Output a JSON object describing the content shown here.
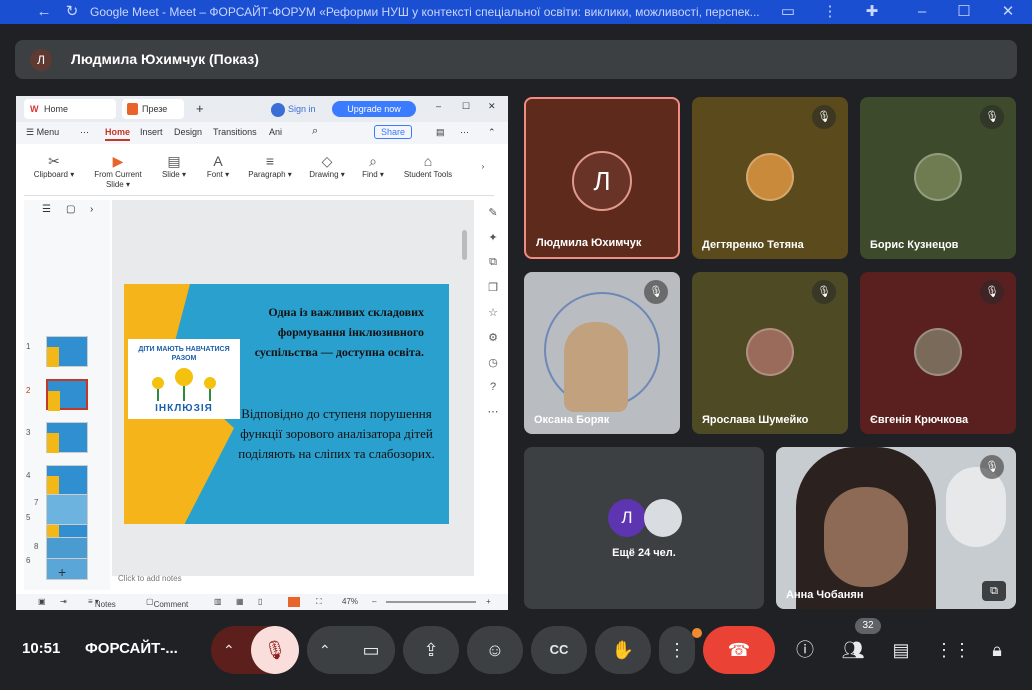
{
  "window": {
    "title": "Google Meet - Meet – ФОРСАЙТ-ФОРУМ «Реформи НУШ у контексті спеціальної освіти: виклики, можливості, перспек..."
  },
  "presenter": {
    "initial": "Л",
    "label": "Людмила Юхимчук (Показ)"
  },
  "presentation_app": {
    "tabs": [
      {
        "label": "Home"
      },
      {
        "label": "Презе"
      }
    ],
    "signin": "Sign in",
    "upgrade": "Upgrade now",
    "menu_label": "Menu",
    "ribbon_tabs": [
      "Home",
      "Insert",
      "Design",
      "Transitions",
      "Ani"
    ],
    "share_label": "Share",
    "ribbon_buttons": [
      "Clipboard",
      "From Current Slide",
      "Slide",
      "Font",
      "Paragraph",
      "Drawing",
      "Find",
      "Student Tools"
    ],
    "slide_numbers": [
      "1",
      "2",
      "3",
      "4",
      "5",
      "6",
      "7",
      "8"
    ],
    "slide": {
      "heading": "Одна із важливих складових формування інклюзивного суспільства — доступна освіта.",
      "body": "Відповідно до ступеня порушення функції зорового аналізатора дітей поділяють на сліпих та слабозорих.",
      "logo_top": "ДІТИ МАЮТЬ НАВЧАТИСЯ РАЗОМ",
      "logo_bottom": "ІНКЛЮЗІЯ"
    },
    "notes_placeholder": "Click to add notes",
    "status": {
      "notes": "Notes",
      "comment": "Comment",
      "zoom": "47%"
    }
  },
  "participants": [
    {
      "name": "Людмила Юхимчук",
      "initial": "Л",
      "muted": false
    },
    {
      "name": "Дегтяренко Тетяна",
      "muted": true
    },
    {
      "name": "Борис Кузнецов",
      "muted": true
    },
    {
      "name": "Оксана Боряк",
      "muted": true
    },
    {
      "name": "Ярослава Шумейко",
      "muted": true
    },
    {
      "name": "Євгенія Крючкова",
      "muted": true
    },
    {
      "name": "Анна Чобанян",
      "muted": true
    }
  ],
  "others": {
    "label": "Ещё 24 чел.",
    "initial": "Л"
  },
  "controls": {
    "time": "10:51",
    "meeting_name": "ФОРСАЙТ-...",
    "participant_count": "32"
  },
  "colors": {
    "end_call": "#ea4335",
    "mic_off_bg": "#f9dedc",
    "titlebar": "#1a4fd1",
    "speaking_border": "#f28b82"
  }
}
